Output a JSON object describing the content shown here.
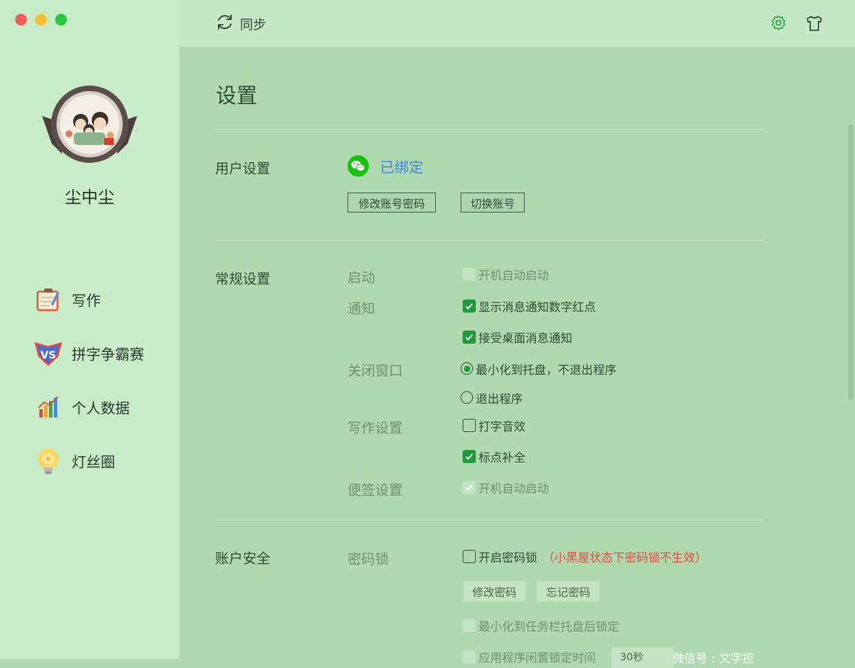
{
  "user": {
    "name": "尘中尘"
  },
  "nav": [
    {
      "label": "写作",
      "icon": "notepad-icon"
    },
    {
      "label": "拼字争霸赛",
      "icon": "vs-badge-icon"
    },
    {
      "label": "个人数据",
      "icon": "bar-chart-icon"
    },
    {
      "label": "灯丝圈",
      "icon": "lightbulb-icon"
    }
  ],
  "topbar": {
    "sync_label": "同步"
  },
  "settings": {
    "title": "设置",
    "user_section": {
      "title": "用户设置",
      "bound_label": "已绑定",
      "change_password_button": "修改账号密码",
      "switch_account_button": "切换账号"
    },
    "general": {
      "title": "常规设置",
      "startup_label": "启动",
      "startup_option": "开机自动启动",
      "notify_label": "通知",
      "notify_option_1": "显示消息通知数字红点",
      "notify_option_2": "接受桌面消息通知",
      "close_label": "关闭窗口",
      "close_option_1": "最小化到托盘，不退出程序",
      "close_option_2": "退出程序",
      "writing_label": "写作设置",
      "writing_option_1": "打字音效",
      "writing_option_2": "标点补全",
      "note_label": "便签设置",
      "note_option": "开机自动启动"
    },
    "security": {
      "title": "账户安全",
      "lock_label": "密码锁",
      "lock_option": "开启密码锁",
      "lock_warning": "（小黑屋状态下密码锁不生效）",
      "modify_password_button": "修改密码",
      "forgot_password_button": "忘记密码",
      "minimize_lock_option": "最小化到任务栏托盘后锁定",
      "idle_lock_option": "应用程序闲置锁定时间",
      "idle_time_value": "30秒"
    }
  },
  "watermark": "微信号 : 文字控",
  "colors": {
    "accent_green": "#1e9a3a",
    "link_blue": "#3e86e0",
    "warning_red": "#e6483b"
  }
}
